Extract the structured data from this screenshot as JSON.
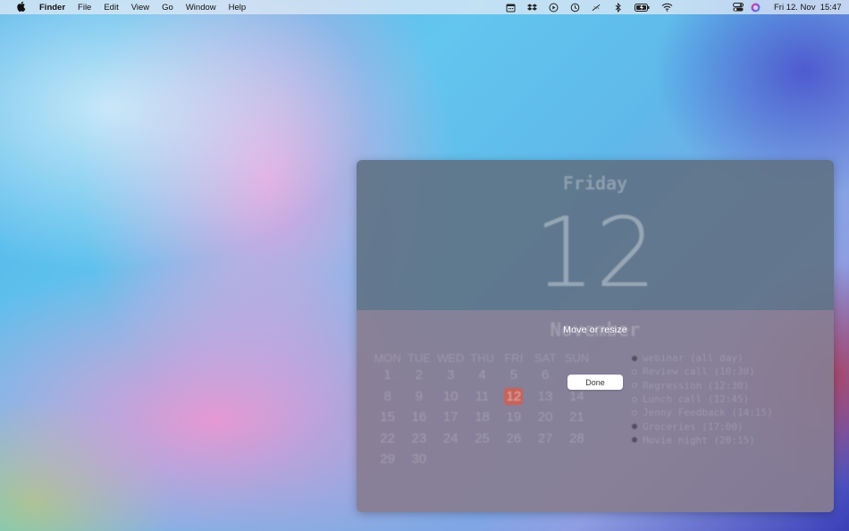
{
  "menubar": {
    "apple_glyph": "",
    "app_name": "Finder",
    "menus": [
      "File",
      "Edit",
      "View",
      "Go",
      "Window",
      "Help"
    ],
    "status_icons": [
      "calendar-icon",
      "dropbox-icon",
      "play-circle-icon",
      "time-machine-icon",
      "slash-icon",
      "bluetooth-icon",
      "battery-icon",
      "wifi-icon"
    ],
    "right_icons": [
      "control-center-icon",
      "siri-icon"
    ],
    "clock": "Fri 12. Nov  15:47"
  },
  "widget": {
    "day_name": "Friday",
    "day_number": "12",
    "month": "November",
    "weekdays": [
      "MON",
      "TUE",
      "WED",
      "THU",
      "FRI",
      "SAT",
      "SUN"
    ],
    "weeks": [
      [
        "1",
        "2",
        "3",
        "4",
        "5",
        "6",
        ""
      ],
      [
        "8",
        "9",
        "10",
        "11",
        "12",
        "13",
        "14"
      ],
      [
        "15",
        "16",
        "17",
        "18",
        "19",
        "20",
        "21"
      ],
      [
        "22",
        "23",
        "24",
        "25",
        "26",
        "27",
        "28"
      ],
      [
        "29",
        "30",
        "",
        "",
        "",
        "",
        ""
      ]
    ],
    "today": "12",
    "events": [
      {
        "text": "webinar  (all day)",
        "filled": true
      },
      {
        "text": "Review call (10:30)",
        "filled": false
      },
      {
        "text": "Regression (12:30)",
        "filled": false
      },
      {
        "text": "Lunch call (12:45)",
        "filled": false
      },
      {
        "text": "Jenny Feedback (14:15)",
        "filled": false
      },
      {
        "text": "Groceries (17:00)",
        "filled": true
      },
      {
        "text": "Movie night (20:15)",
        "filled": true
      }
    ],
    "overlay_label": "Move or resize",
    "done_label": "Done"
  }
}
